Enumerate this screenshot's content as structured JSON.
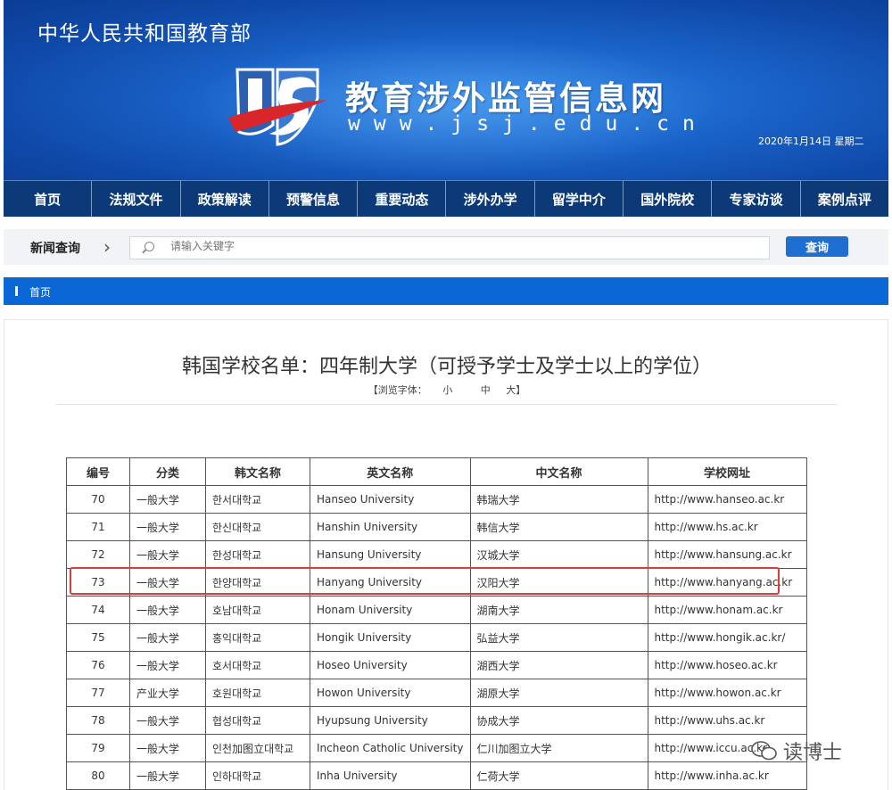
{
  "header": {
    "ministry": "中华人民共和国教育部",
    "site_title": "教育涉外监管信息网",
    "site_url": "www.jsj.edu.cn",
    "date": "2020年1月14日  星期二"
  },
  "nav": [
    "首页",
    "法规文件",
    "政策解读",
    "预警信息",
    "重要动态",
    "涉外办学",
    "留学中介",
    "国外院校",
    "专家访谈",
    "案例点评"
  ],
  "search": {
    "label": "新闻查询",
    "placeholder": "请输入关键字",
    "button": "查询"
  },
  "breadcrumb": "首页",
  "article": {
    "title": "韩国学校名单：四年制大学（可授予学士及学士以上的学位）",
    "font_label": "【浏览字体：",
    "font_small": "小",
    "font_medium": "中",
    "font_large": "大】"
  },
  "table": {
    "headers": [
      "编号",
      "分类",
      "韩文名称",
      "英文名称",
      "中文名称",
      "学校网址"
    ],
    "rows": [
      [
        "70",
        "一般大学",
        "한서대학교",
        "Hanseo University",
        "韩瑞大学",
        "http://www.hanseo.ac.kr"
      ],
      [
        "71",
        "一般大学",
        "한신대학교",
        "Hanshin University",
        "韩信大学",
        "http://www.hs.ac.kr"
      ],
      [
        "72",
        "一般大学",
        "한성대학교",
        "Hansung University",
        "汉城大学",
        "http://www.hansung.ac.kr"
      ],
      [
        "73",
        "一般大学",
        "한양대학교",
        "Hanyang University",
        "汉阳大学",
        "http://www.hanyang.ac.kr"
      ],
      [
        "74",
        "一般大学",
        "호남대학교",
        "Honam University",
        "湖南大学",
        "http://www.honam.ac.kr"
      ],
      [
        "75",
        "一般大学",
        "홍익대학교",
        "Hongik University",
        "弘益大学",
        "http://www.hongik.ac.kr/"
      ],
      [
        "76",
        "一般大学",
        "호서대학교",
        "Hoseo University",
        "湖西大学",
        "http://www.hoseo.ac.kr"
      ],
      [
        "77",
        "产业大学",
        "호원대학교",
        "Howon University",
        "湖原大学",
        "http://www.howon.ac.kr"
      ],
      [
        "78",
        "一般大学",
        "협성대학교",
        "Hyupsung University",
        "协成大学",
        "http://www.uhs.ac.kr"
      ],
      [
        "79",
        "一般大学",
        "인천加图立대학교",
        "Incheon Catholic University",
        "仁川加图立大学",
        "http://www.iccu.ac.kr"
      ],
      [
        "80",
        "一般大学",
        "인하대학교",
        "Inha University",
        "仁荷大学",
        "http://www.inha.ac.kr"
      ]
    ]
  },
  "watermark": "读博士",
  "colors": {
    "nav_bg": "#0c3a78",
    "breadcrumb_bg": "#0c67d6",
    "button_bg": "#1f6fd3",
    "highlight_border": "#e03b3b"
  }
}
